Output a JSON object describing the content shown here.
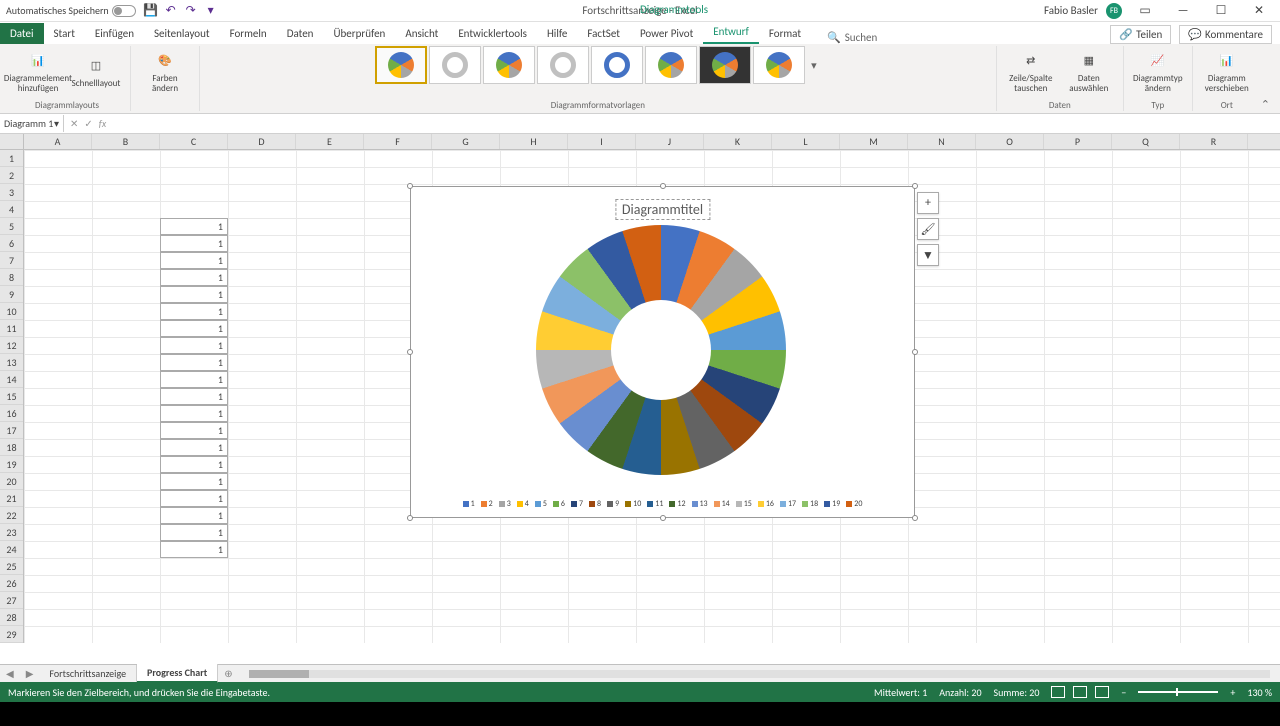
{
  "titlebar": {
    "autosave": "Automatisches Speichern",
    "doc_title": "Fortschrittsanzeige - Excel",
    "diagtools": "Diagrammtools",
    "user": "Fabio Basler",
    "user_initials": "FB"
  },
  "ribbon": {
    "tabs": [
      "Datei",
      "Start",
      "Einfügen",
      "Seitenlayout",
      "Formeln",
      "Daten",
      "Überprüfen",
      "Ansicht",
      "Entwicklertools",
      "Hilfe",
      "FactSet",
      "Power Pivot",
      "Entwurf",
      "Format"
    ],
    "search": "Suchen",
    "share": "Teilen",
    "comments": "Kommentare",
    "groups": {
      "layouts": {
        "add_element": "Diagrammelement hinzufügen",
        "quick_layout": "Schnelllayout",
        "colors": "Farben ändern",
        "label": "Diagrammlayouts"
      },
      "styles_label": "Diagrammformatvorlagen",
      "data": {
        "switch": "Zeile/Spalte tauschen",
        "select": "Daten auswählen",
        "label": "Daten"
      },
      "type": {
        "change": "Diagrammtyp ändern",
        "label": "Typ"
      },
      "location": {
        "move": "Diagramm verschieben",
        "label": "Ort"
      }
    }
  },
  "namebox": "Diagramm 1",
  "columns": [
    "A",
    "B",
    "C",
    "D",
    "E",
    "F",
    "G",
    "H",
    "I",
    "J",
    "K",
    "L",
    "M",
    "N",
    "O",
    "P",
    "Q",
    "R"
  ],
  "rows_visible": 29,
  "data_column": "C",
  "data_start_row": 5,
  "data_end_row": 24,
  "cell_value": "1",
  "chart_data": {
    "type": "pie",
    "title": "Diagrammtitel",
    "categories": [
      "1",
      "2",
      "3",
      "4",
      "5",
      "6",
      "7",
      "8",
      "9",
      "10",
      "11",
      "12",
      "13",
      "14",
      "15",
      "16",
      "17",
      "18",
      "19",
      "20"
    ],
    "values": [
      1,
      1,
      1,
      1,
      1,
      1,
      1,
      1,
      1,
      1,
      1,
      1,
      1,
      1,
      1,
      1,
      1,
      1,
      1,
      1
    ],
    "colors": [
      "#4472c4",
      "#ed7d31",
      "#a5a5a5",
      "#ffc000",
      "#5b9bd5",
      "#70ad47",
      "#264478",
      "#9e480e",
      "#636363",
      "#997300",
      "#255e91",
      "#43682b",
      "#698ed0",
      "#f1975a",
      "#b7b7b7",
      "#ffcd33",
      "#7cafdd",
      "#8cc168",
      "#335aa1",
      "#d26012"
    ]
  },
  "sheet_tabs": [
    "Fortschrittsanzeige",
    "Progress Chart"
  ],
  "statusbar": {
    "msg": "Markieren Sie den Zielbereich, und drücken Sie die Eingabetaste.",
    "avg_label": "Mittelwert:",
    "avg": "1",
    "count_label": "Anzahl:",
    "count": "20",
    "sum_label": "Summe:",
    "sum": "20",
    "zoom": "130 %"
  }
}
